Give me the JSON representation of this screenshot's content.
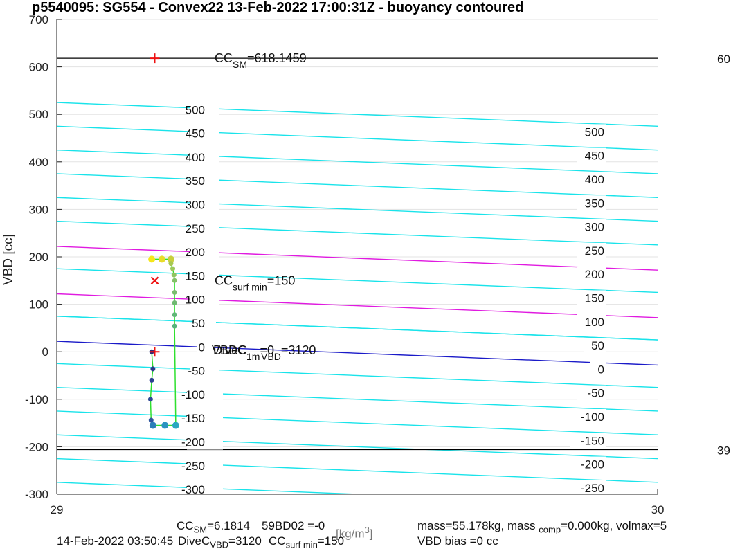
{
  "chart_data": {
    "type": "scatter",
    "title": "p5540095: SG554 - Convex22 13-Feb-2022 17:00:31Z - buoyancy contoured",
    "ylabel": "VBD [cc]",
    "xlabel": "",
    "xlim": [
      29,
      30
    ],
    "ylim": [
      -300,
      700
    ],
    "x_ticks": [
      "29",
      "30"
    ],
    "y_ticks": [
      "700",
      "600",
      "500",
      "400",
      "300",
      "200",
      "100",
      "0",
      "-100",
      "-200",
      "-300"
    ],
    "grid": true,
    "contours_cyan": [
      {
        "level": 500,
        "y_left": 525,
        "y_right": 475
      },
      {
        "level": 450,
        "y_left": 475,
        "y_right": 425
      },
      {
        "level": 400,
        "y_left": 425,
        "y_right": 375
      },
      {
        "level": 350,
        "y_left": 375,
        "y_right": 325
      },
      {
        "level": 300,
        "y_left": 325,
        "y_right": 275
      },
      {
        "level": 250,
        "y_left": 275,
        "y_right": 225
      },
      {
        "level": 150,
        "y_left": 175,
        "y_right": 125
      },
      {
        "level": 100,
        "y_left": 75,
        "y_right": 25
      },
      {
        "level": 50,
        "y_left": 75,
        "y_right": 25
      },
      {
        "level": -50,
        "y_left": -25,
        "y_right": -75
      },
      {
        "level": -100,
        "y_left": -75,
        "y_right": -125
      },
      {
        "level": -150,
        "y_left": -125,
        "y_right": -175
      },
      {
        "level": -200,
        "y_left": -175,
        "y_right": -225
      },
      {
        "level": -250,
        "y_left": -225,
        "y_right": -275
      },
      {
        "level": -300,
        "y_left": -275,
        "y_right": -325
      }
    ],
    "contours_magenta": [
      {
        "level": 200,
        "y_left": 222,
        "y_right": 172
      },
      {
        "level": 100,
        "y_left": 122,
        "y_right": 72
      }
    ],
    "contour_zero": {
      "level": 0,
      "y_left": 22,
      "y_right": -28
    },
    "contour_labels_left": [
      {
        "text": "500",
        "y": 510
      },
      {
        "text": "450",
        "y": 460
      },
      {
        "text": "400",
        "y": 410
      },
      {
        "text": "350",
        "y": 360
      },
      {
        "text": "300",
        "y": 310
      },
      {
        "text": "250",
        "y": 260
      },
      {
        "text": "200",
        "y": 210
      },
      {
        "text": "150",
        "y": 160
      },
      {
        "text": "100",
        "y": 110
      },
      {
        "text": "50",
        "y": 60
      },
      {
        "text": "0",
        "y": 10
      },
      {
        "text": "-50",
        "y": -40
      },
      {
        "text": "-100",
        "y": -90
      },
      {
        "text": "-150",
        "y": -140
      },
      {
        "text": "-200",
        "y": -190
      },
      {
        "text": "-250",
        "y": -240
      },
      {
        "text": "-300",
        "y": -290
      }
    ],
    "contour_labels_right": [
      {
        "text": "500",
        "y": 475
      },
      {
        "text": "450",
        "y": 425
      },
      {
        "text": "400",
        "y": 375
      },
      {
        "text": "350",
        "y": 325
      },
      {
        "text": "300",
        "y": 275
      },
      {
        "text": "250",
        "y": 225
      },
      {
        "text": "200",
        "y": 175
      },
      {
        "text": "150",
        "y": 125
      },
      {
        "text": "100",
        "y": 75
      },
      {
        "text": "50",
        "y": 25
      },
      {
        "text": "0",
        "y": -25
      },
      {
        "text": "-50",
        "y": -75
      },
      {
        "text": "-100",
        "y": -125
      },
      {
        "text": "-150",
        "y": -175
      },
      {
        "text": "-200",
        "y": -225
      },
      {
        "text": "-250",
        "y": -275
      }
    ],
    "hlines": [
      {
        "y": 618.1459,
        "right_label": "60"
      },
      {
        "y": -206,
        "right_label": "39"
      }
    ],
    "markers": [
      {
        "type": "plus",
        "x": 29.163,
        "y": 618.1459,
        "label": "CC",
        "sub": "SM",
        "value": "=618.1459"
      },
      {
        "type": "cross",
        "x": 29.163,
        "y": 150,
        "label": "CC",
        "sub": "surf min",
        "value": "=150"
      },
      {
        "type": "plus",
        "x": 29.163,
        "y": 0
      }
    ],
    "vbdc_label": {
      "text": "VBDC",
      "sub": "1m",
      "value": "=0",
      "overlay": "DiveC",
      "overlay_sub": "VBD",
      "overlay_value": "=3120"
    },
    "profile": {
      "descent": [
        {
          "x": 29.158,
          "y": 195
        },
        {
          "x": 29.175,
          "y": 195
        },
        {
          "x": 29.19,
          "y": 195
        },
        {
          "x": 29.19,
          "y": 186
        },
        {
          "x": 29.193,
          "y": 175
        },
        {
          "x": 29.195,
          "y": 162
        },
        {
          "x": 29.196,
          "y": 150
        },
        {
          "x": 29.196,
          "y": 125
        },
        {
          "x": 29.196,
          "y": 103
        },
        {
          "x": 29.196,
          "y": 78
        },
        {
          "x": 29.196,
          "y": 54
        }
      ],
      "ascent": [
        {
          "x": 29.158,
          "y": 0
        },
        {
          "x": 29.16,
          "y": -36
        },
        {
          "x": 29.158,
          "y": -60
        },
        {
          "x": 29.156,
          "y": -100
        },
        {
          "x": 29.157,
          "y": -144
        },
        {
          "x": 29.16,
          "y": -155
        },
        {
          "x": 29.18,
          "y": -155
        },
        {
          "x": 29.198,
          "y": -155
        }
      ]
    }
  },
  "footer": {
    "line1_a": "CC",
    "line1_a_sub": "SM",
    "line1_a_val": "=6.1814",
    "line1_overlap": "59BD02 =-0",
    "line1_unit": "[kg/m",
    "line1_unit_sup": "3",
    "line1_unit_end": "]",
    "line1_mass": "mass=55.178kg, mass",
    "line1_mass_sub": "comp",
    "line1_mass_rest": "=0.000kg, volmax=5",
    "line2_date": "14-Feb-2022 03:50:45",
    "line2_divec": "DiveC",
    "line2_divec_sub": "VBD",
    "line2_divec_val": "=3120",
    "line2_ccsurf": "CC",
    "line2_ccsurf_sub": "surf min",
    "line2_ccsurf_val": "=150",
    "line2_bias": "VBD bias =0 cc"
  }
}
